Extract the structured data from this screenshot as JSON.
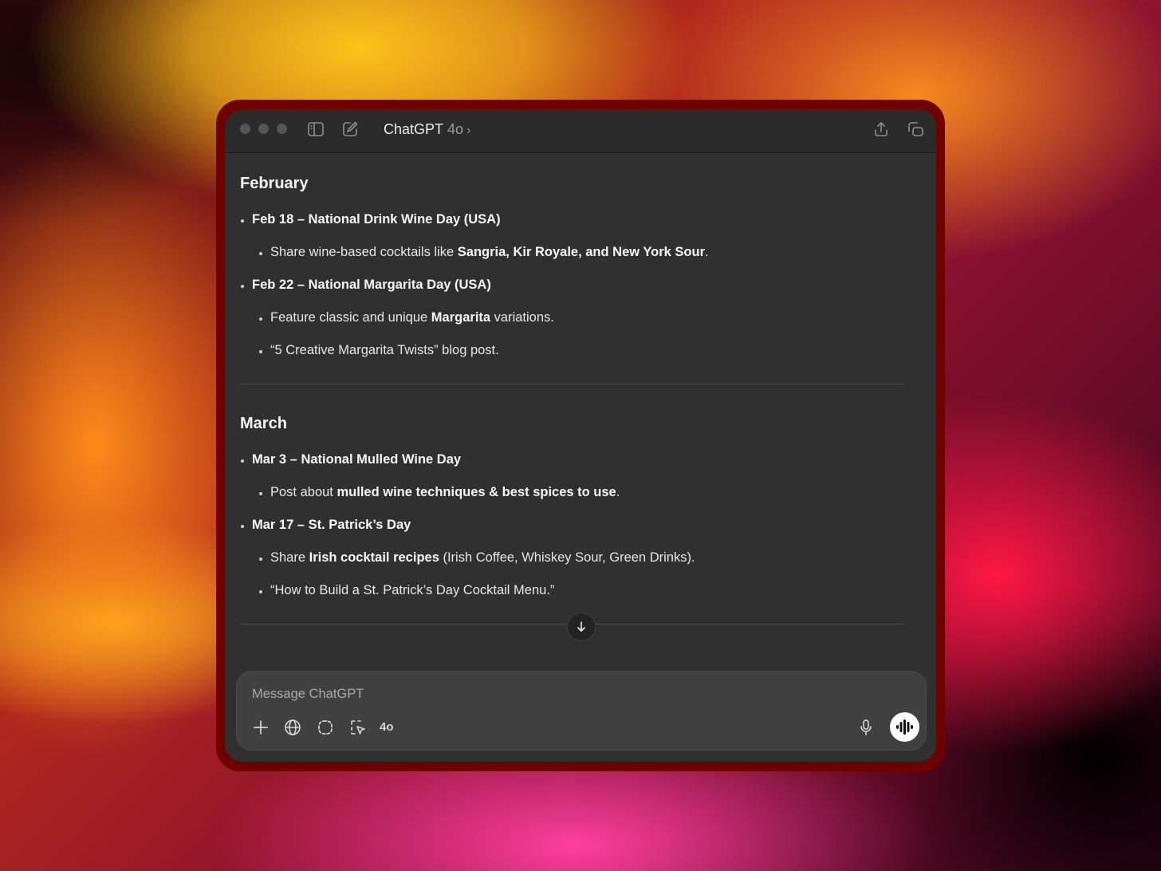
{
  "window": {
    "app_name": "ChatGPT",
    "model": "4o",
    "chevron": "›"
  },
  "icons": {
    "sidebar": "sidebar-toggle-icon",
    "new_chat": "new-chat-icon",
    "share": "share-icon",
    "new_window": "new-window-icon",
    "scroll_down": "arrow-down-icon",
    "attach": "plus-icon",
    "search": "globe-icon",
    "screenshot": "lasso-icon",
    "pointer": "pointer-select-icon",
    "mic": "microphone-icon",
    "voice": "voice-waveform-icon"
  },
  "colors": {
    "window_bg": "#303030",
    "accent_glow": "#6e0000"
  },
  "message": {
    "sections": [
      {
        "title": "February",
        "items": [
          {
            "heading": "Feb 18 – National Drink Wine Day (USA)",
            "bullets": [
              {
                "pre": "Share wine-based cocktails like ",
                "bold": "Sangria, Kir Royale, and New York Sour",
                "post": "."
              }
            ]
          },
          {
            "heading": "Feb 22 – National Margarita Day (USA)",
            "bullets": [
              {
                "pre": "Feature classic and unique ",
                "bold": "Margarita",
                "post": " variations."
              },
              {
                "pre": "“5 Creative Margarita Twists” blog post.",
                "bold": "",
                "post": ""
              }
            ]
          }
        ]
      },
      {
        "title": "March",
        "items": [
          {
            "heading": "Mar 3 – National Mulled Wine Day",
            "bullets": [
              {
                "pre": "Post about ",
                "bold": "mulled wine techniques & best spices to use",
                "post": "."
              }
            ]
          },
          {
            "heading": "Mar 17 – St. Patrick’s Day",
            "bullets": [
              {
                "pre": "Share ",
                "bold": "Irish cocktail recipes",
                "post": " (Irish Coffee, Whiskey Sour, Green Drinks)."
              },
              {
                "pre": "“How to Build a St. Patrick’s Day Cocktail Menu.”",
                "bold": "",
                "post": ""
              }
            ]
          }
        ]
      }
    ]
  },
  "composer": {
    "placeholder": "Message ChatGPT",
    "value": "",
    "model_chip": "4o"
  }
}
